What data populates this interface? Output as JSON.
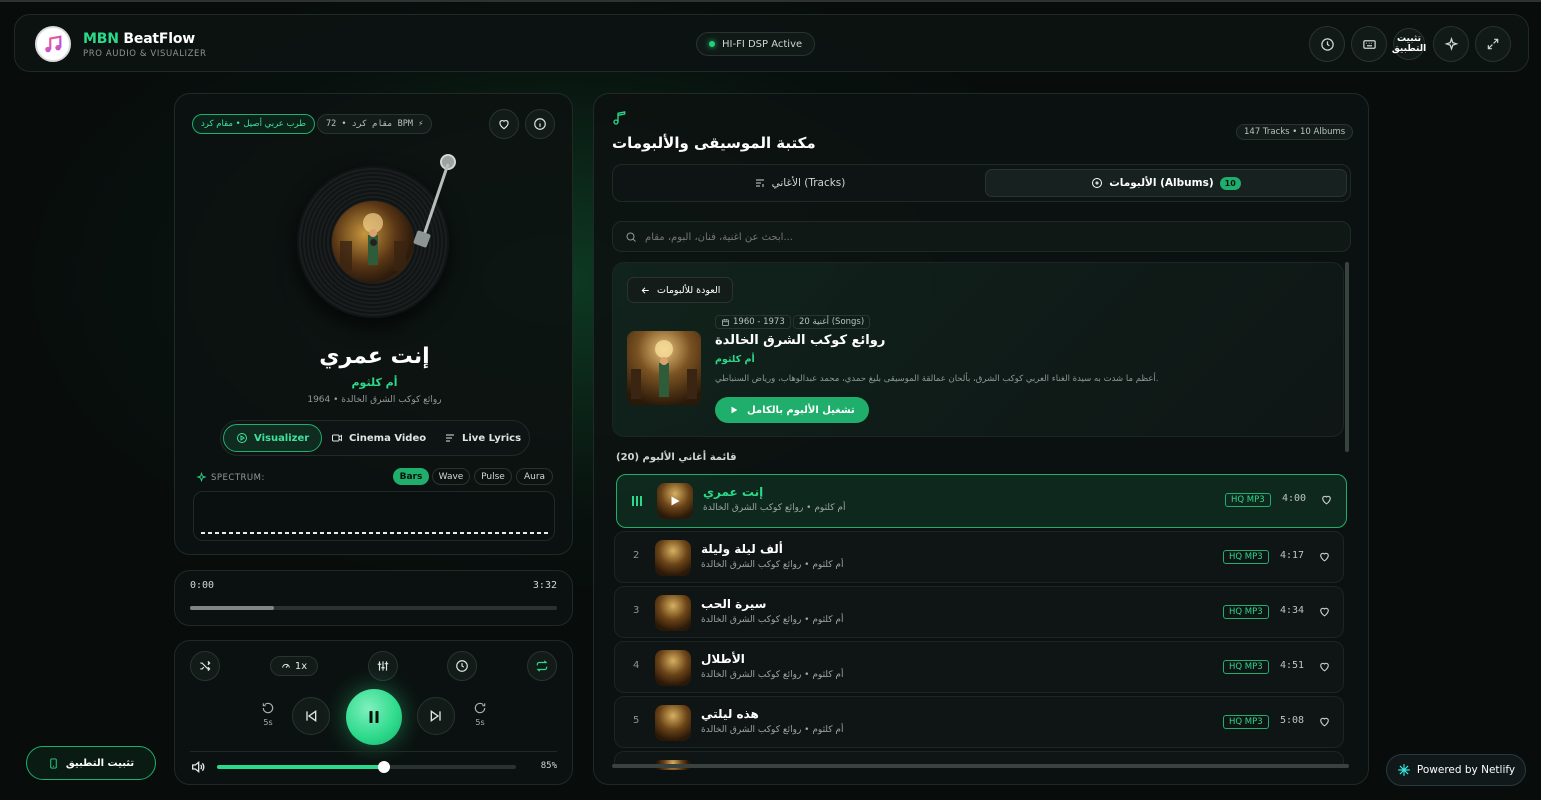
{
  "header": {
    "brand_prefix": "MBN",
    "brand_name": "BeatFlow",
    "brand_sub": "PRO AUDIO & VISUALIZER",
    "dsp_status": "HI-FI DSP Active",
    "install_label": "تثبيت التطبيق",
    "icons": [
      "clock-icon",
      "keyboard-icon",
      "sparkle-icon",
      "expand-icon"
    ]
  },
  "now_playing": {
    "genre_chip": "طرب عربي أصيل • مقام كرد",
    "info_chip": "مقام كرد • 72 BPM ⚡",
    "title": "إنت عمري",
    "artist": "أم كلثوم",
    "album_year": "روائع كوكب الشرق الخالدة • 1964",
    "tabs": [
      "Visualizer",
      "Cinema Video",
      "Live Lyrics"
    ],
    "active_tab": 0,
    "spectrum_label": "SPECTRUM:",
    "spectrum_modes": [
      "Bars",
      "Wave",
      "Pulse",
      "Aura"
    ],
    "active_mode": 0
  },
  "progress": {
    "current": "0:00",
    "total": "3:32",
    "fraction": 0.23
  },
  "controls": {
    "speed": "1x",
    "rewind_label": "5s",
    "forward_label": "5s",
    "volume": "85%",
    "volume_fraction": 0.56
  },
  "install_button": "تثبيت التطبيق",
  "library": {
    "title": "مكتبة الموسيقى والألبومات",
    "counts": "147 Tracks • 10 Albums",
    "tab_tracks": "الأغاني (Tracks)",
    "tab_albums": "الألبومات (Albums)",
    "albums_count": "10",
    "search_placeholder": "ابحث عن أغنية، فنان، ألبوم، مقام...",
    "back_button": "العودة للألبومات",
    "album": {
      "years": "1960 - 1973",
      "songs": "20 أغنية (Songs)",
      "title": "روائع كوكب الشرق الخالدة",
      "artist": "أم كلثوم",
      "description": "أعظم ما شدت به سيدة الغناء العربي كوكب الشرق، بألحان عمالقة الموسيقى بليغ حمدي، محمد عبدالوهاب، ورياض السنباطي.",
      "play_all": "تشغيل الألبوم بالكامل"
    },
    "list_heading": "قائمة أغاني الألبوم (20)",
    "tracks": [
      {
        "num": "",
        "title": "إنت عمري",
        "sub": "أم كلثوم • روائع كوكب الشرق الخالدة",
        "quality": "HQ MP3",
        "duration": "4:00"
      },
      {
        "num": "2",
        "title": "ألف ليلة وليلة",
        "sub": "أم كلثوم • روائع كوكب الشرق الخالدة",
        "quality": "HQ MP3",
        "duration": "4:17"
      },
      {
        "num": "3",
        "title": "سيرة الحب",
        "sub": "أم كلثوم • روائع كوكب الشرق الخالدة",
        "quality": "HQ MP3",
        "duration": "4:34"
      },
      {
        "num": "4",
        "title": "الأطلال",
        "sub": "أم كلثوم • روائع كوكب الشرق الخالدة",
        "quality": "HQ MP3",
        "duration": "4:51"
      },
      {
        "num": "5",
        "title": "هذه ليلتي",
        "sub": "أم كلثوم • روائع كوكب الشرق الخالدة",
        "quality": "HQ MP3",
        "duration": "5:08"
      }
    ]
  },
  "netlify": "Powered by Netlify",
  "colors": {
    "accent": "#2bd98a",
    "accent_dark": "#1fae6c",
    "bg": "#080d0c"
  }
}
